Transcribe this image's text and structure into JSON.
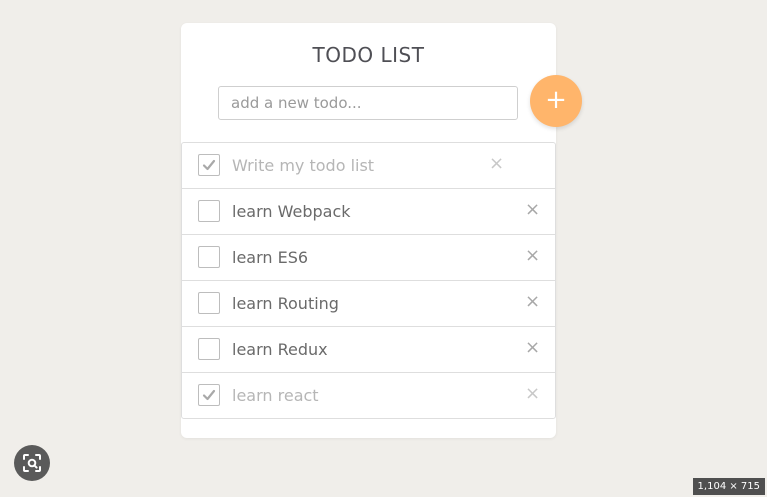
{
  "title": "TODO LIST",
  "input": {
    "placeholder": "add a new todo...",
    "value": ""
  },
  "add_button": {
    "label": "+"
  },
  "todos": [
    {
      "label": "Write my todo list",
      "done": true
    },
    {
      "label": "learn Webpack",
      "done": false
    },
    {
      "label": "learn ES6",
      "done": false
    },
    {
      "label": "learn Routing",
      "done": false
    },
    {
      "label": "learn Redux",
      "done": false
    },
    {
      "label": "learn react",
      "done": true
    }
  ],
  "remove_glyph": "×",
  "footer": {
    "image_size": "1,104 × 715"
  },
  "colors": {
    "background": "#f0eeea",
    "accent": "#ffb56b",
    "text": "#6a6a6a",
    "done_text": "#b6b6b6"
  },
  "icons": {
    "lens": "visual-search-icon",
    "check": "checkmark-icon",
    "remove": "close-icon"
  }
}
